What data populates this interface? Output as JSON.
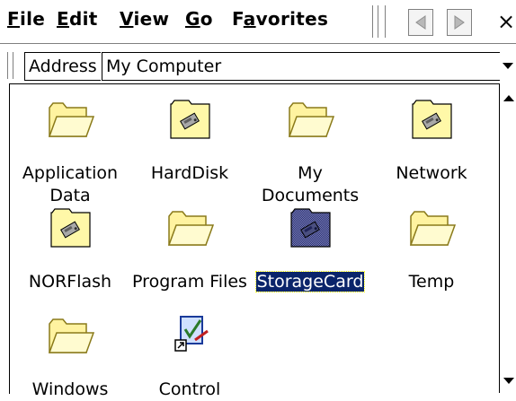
{
  "menubar": {
    "items": [
      {
        "mnemonic": "F",
        "rest": "ile"
      },
      {
        "mnemonic": "E",
        "rest": "dit"
      },
      {
        "mnemonic": "V",
        "rest": "iew"
      },
      {
        "mnemonic": "G",
        "rest": "o"
      },
      {
        "pre": "F",
        "mnemonic": "a",
        "rest": "vorites"
      }
    ],
    "back_icon": "back-arrow-icon",
    "forward_icon": "forward-arrow-icon",
    "close_label": "×"
  },
  "address": {
    "label": "Address",
    "value": "My Computer"
  },
  "items": [
    {
      "label": "Application Data",
      "lines": [
        "Application",
        "Data"
      ],
      "icon": "folder-icon"
    },
    {
      "label": "HardDisk",
      "lines": [
        "HardDisk"
      ],
      "icon": "storage-folder-icon"
    },
    {
      "label": "My Documents",
      "lines": [
        "My",
        "Documents"
      ],
      "icon": "folder-icon"
    },
    {
      "label": "Network",
      "lines": [
        "Network"
      ],
      "icon": "storage-folder-icon"
    },
    {
      "label": "NORFlash",
      "lines": [
        "NORFlash"
      ],
      "icon": "storage-folder-icon"
    },
    {
      "label": "Program Files",
      "lines": [
        "Program Files"
      ],
      "icon": "folder-icon"
    },
    {
      "label": "StorageCard",
      "lines": [
        "StorageCard"
      ],
      "icon": "storage-folder-icon",
      "selected": true
    },
    {
      "label": "Temp",
      "lines": [
        "Temp"
      ],
      "icon": "folder-icon"
    },
    {
      "label": "Windows",
      "lines": [
        "Windows"
      ],
      "icon": "folder-icon"
    },
    {
      "label": "Control",
      "lines": [
        "Control"
      ],
      "icon": "control-panel-icon"
    }
  ],
  "colors": {
    "folder_fill": "#fffbb0",
    "folder_stroke": "#9a8a2a",
    "selection": "#0a246a"
  }
}
